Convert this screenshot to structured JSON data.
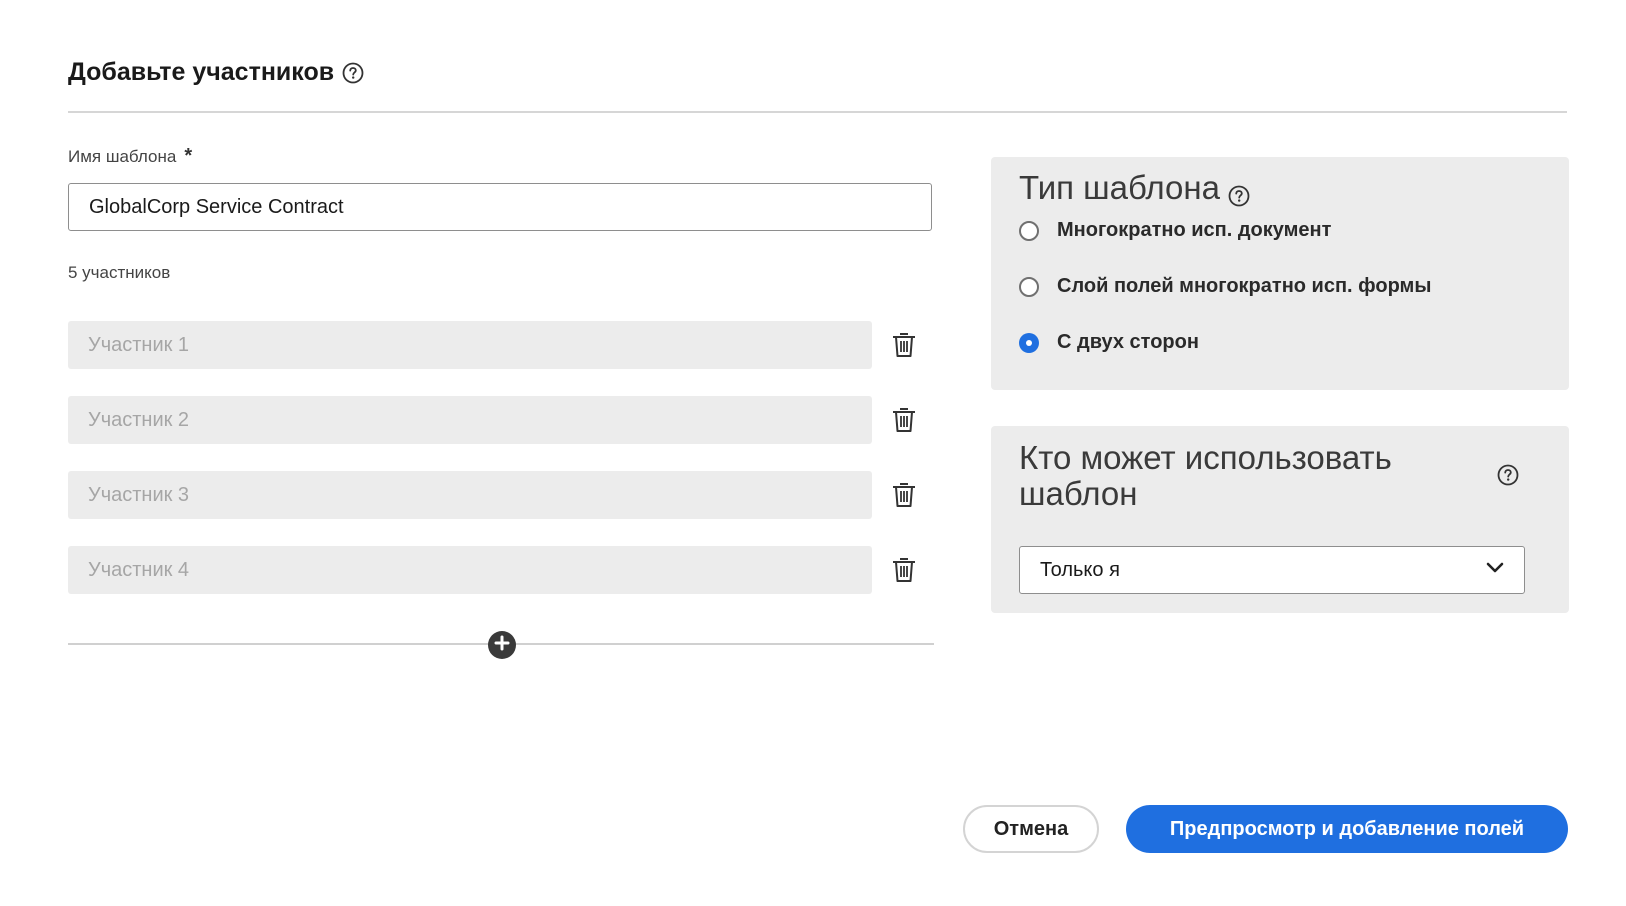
{
  "header": {
    "title": "Добавьте участников",
    "help_icon": "help-circle-icon"
  },
  "template_name": {
    "label": "Имя шаблона",
    "required_mark": "*",
    "value": "GlobalCorp Service Contract"
  },
  "participants": {
    "count_text": "5 участников",
    "items": [
      {
        "placeholder": "Участник 1"
      },
      {
        "placeholder": "Участник 2"
      },
      {
        "placeholder": "Участник 3"
      },
      {
        "placeholder": "Участник 4"
      }
    ],
    "delete_icon": "trash-icon",
    "add_icon": "plus-circle-icon"
  },
  "template_type": {
    "title": "Тип шаблона",
    "options": [
      {
        "label": "Многократно исп. документ",
        "selected": false
      },
      {
        "label": "Слой полей многократно исп. формы",
        "selected": false
      },
      {
        "label": "С двух сторон",
        "selected": true
      }
    ],
    "accent_color": "#1f6fe0"
  },
  "who_can_use": {
    "title": "Кто может использовать шаблон",
    "selected_value": "Только я",
    "dropdown_icon": "chevron-down-icon"
  },
  "footer": {
    "cancel_label": "Отмена",
    "primary_label": "Предпросмотр и добавление полей",
    "primary_color": "#1f6fe0"
  }
}
